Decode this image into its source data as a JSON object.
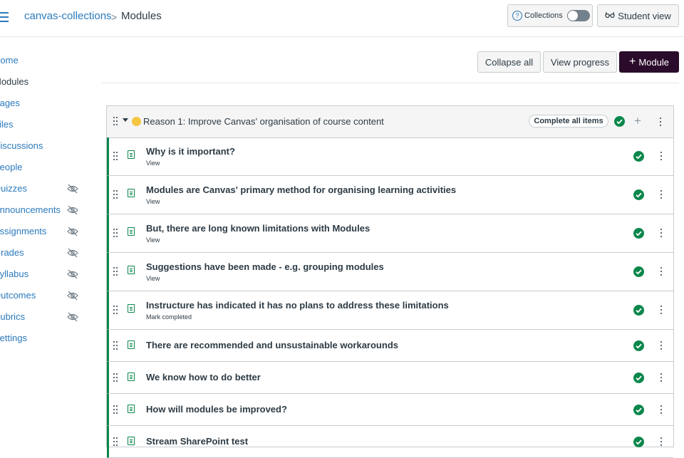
{
  "breadcrumb": {
    "course": "canvas-collections",
    "separator": ">",
    "current": "Modules"
  },
  "header": {
    "collections_label": "Collections",
    "help_glyph": "?",
    "student_view_label": "Student view"
  },
  "nav": {
    "items": [
      {
        "label": "Home",
        "hidden": false,
        "active": false
      },
      {
        "label": "Modules",
        "hidden": false,
        "active": true
      },
      {
        "label": "Pages",
        "hidden": false,
        "active": false
      },
      {
        "label": "Files",
        "hidden": false,
        "active": false
      },
      {
        "label": "Discussions",
        "hidden": false,
        "active": false
      },
      {
        "label": "People",
        "hidden": false,
        "active": false
      },
      {
        "label": "Quizzes",
        "hidden": true,
        "active": false
      },
      {
        "label": "Announcements",
        "hidden": true,
        "active": false
      },
      {
        "label": "Assignments",
        "hidden": true,
        "active": false
      },
      {
        "label": "Grades",
        "hidden": true,
        "active": false
      },
      {
        "label": "Syllabus",
        "hidden": true,
        "active": false
      },
      {
        "label": "Outcomes",
        "hidden": true,
        "active": false
      },
      {
        "label": "Rubrics",
        "hidden": true,
        "active": false
      },
      {
        "label": "Settings",
        "hidden": false,
        "active": false
      }
    ]
  },
  "toolbar": {
    "collapse_all": "Collapse all",
    "view_progress": "View progress",
    "add_module": "Module"
  },
  "module": {
    "title": "Reason 1: Improve Canvas' organisation of course content",
    "requirement": "Complete all items",
    "items": [
      {
        "title": "Why is it important?",
        "requirement": "View"
      },
      {
        "title": "Modules are Canvas' primary method for organising learning activities",
        "requirement": "View"
      },
      {
        "title": "But, there are long known limitations with Modules",
        "requirement": "View"
      },
      {
        "title": "Suggestions have been made - e.g. grouping modules",
        "requirement": "View"
      },
      {
        "title": "Instructure has indicated it has no plans to address these limitations",
        "requirement": "Mark completed"
      },
      {
        "title": "There are recommended and unsustainable workarounds",
        "requirement": ""
      },
      {
        "title": "We know how to do better",
        "requirement": ""
      },
      {
        "title": "How will modules be improved?",
        "requirement": ""
      },
      {
        "title": "Stream SharePoint test",
        "requirement": ""
      }
    ]
  },
  "colors": {
    "link": "#2b7abc",
    "success": "#0b874b",
    "primary_button": "#2b0b2b"
  }
}
